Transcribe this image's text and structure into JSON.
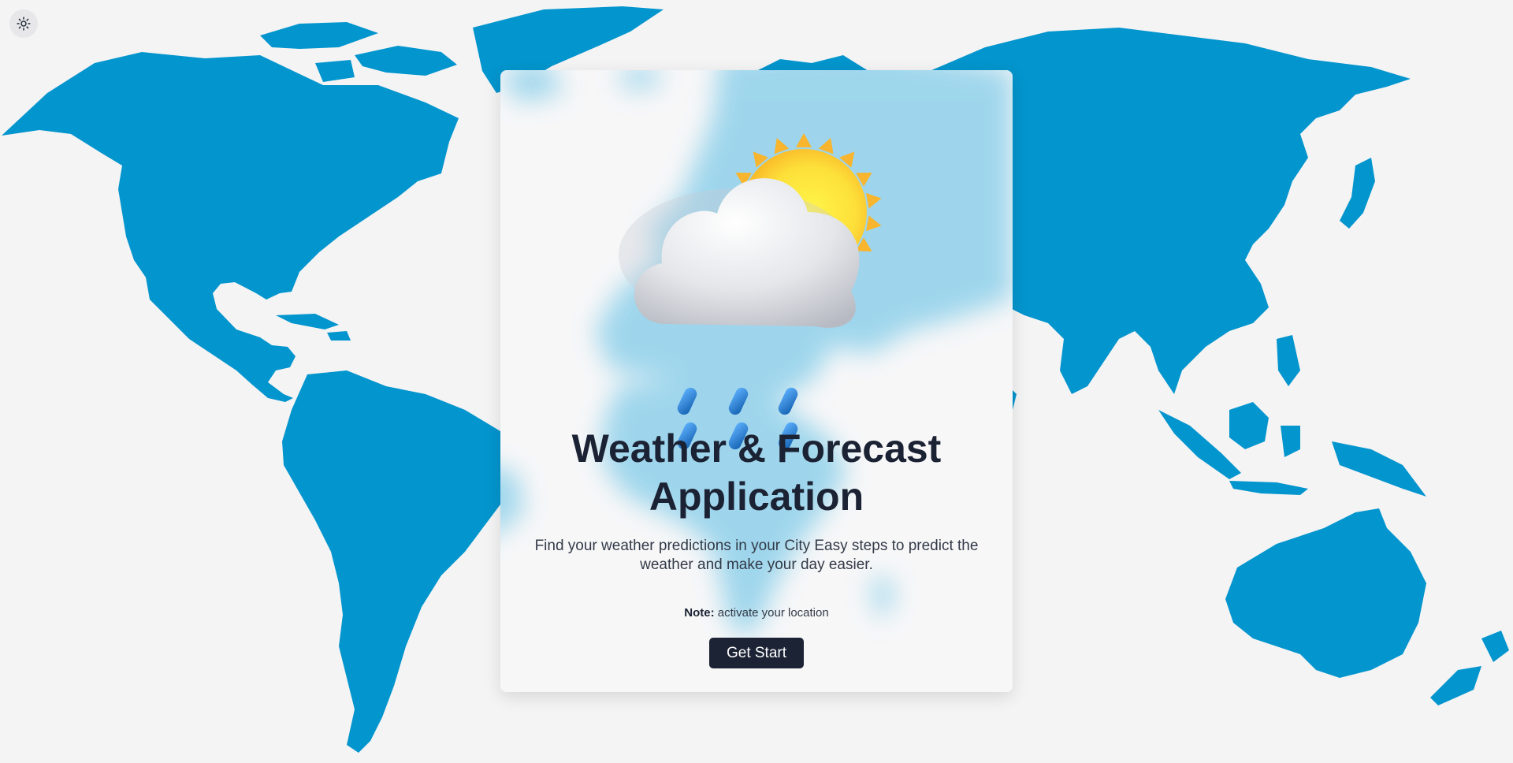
{
  "theme_toggle": {
    "icon": "sun-icon"
  },
  "card": {
    "illustration": "sun-behind-rain-cloud",
    "title_line1": "Weather & Forecast",
    "title_line2": "Application",
    "description": "Find your weather predictions in your City Easy steps to predict the weather and make your day easier.",
    "note_label": "Note:",
    "note_text": "activate your location",
    "cta_label": "Get Start"
  },
  "colors": {
    "background": "#f4f4f5",
    "map": "#0395cd",
    "card": "#f7f7f8",
    "title": "#1b2233",
    "button": "#1c2335",
    "sun": "#fdd83a",
    "raindrop": "#1f78c8"
  }
}
